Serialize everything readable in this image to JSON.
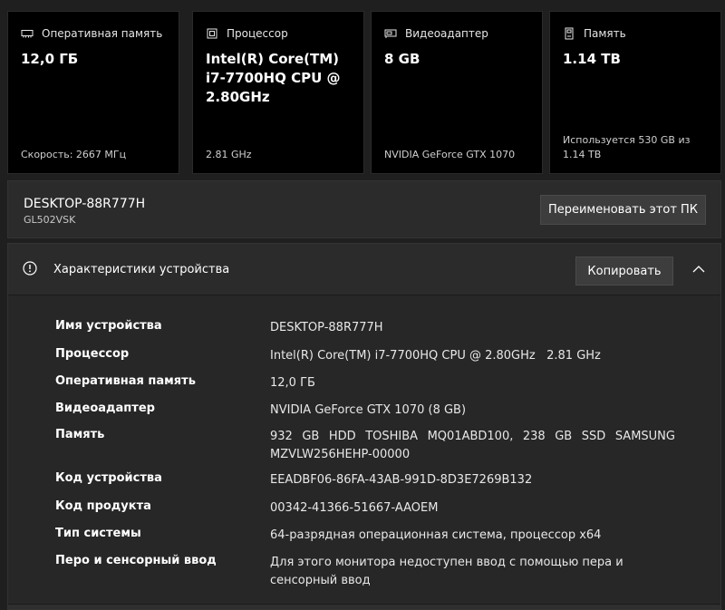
{
  "cards": [
    {
      "icon": "memory-icon",
      "title": "Оперативная память",
      "value": "12,0 ГБ",
      "footer": "Скорость: 2667 МГц"
    },
    {
      "icon": "cpu-icon",
      "title": "Процессор",
      "value": "Intel(R) Core(TM) i7-7700HQ CPU @ 2.80GHz",
      "footer": "2.81 GHz"
    },
    {
      "icon": "gpu-icon",
      "title": "Видеоадаптер",
      "value": "8 GB",
      "footer": "NVIDIA GeForce GTX 1070"
    },
    {
      "icon": "storage-icon",
      "title": "Память",
      "value": "1.14 TB",
      "footer": "Используется 530 GB из 1.14 TB"
    }
  ],
  "device": {
    "name": "DESKTOP-88R777H",
    "model": "GL502VSK",
    "rename_label": "Переименовать этот ПК"
  },
  "specs": {
    "icon": "info-icon",
    "title": "Характеристики устройства",
    "copy_label": "Копировать",
    "collapse_icon": "chevron-up-icon",
    "rows": [
      {
        "label": "Имя устройства",
        "value": "DESKTOP-88R777H"
      },
      {
        "label": "Процессор",
        "value": "Intel(R) Core(TM) i7-7700HQ CPU @ 2.80GHz   2.81 GHz"
      },
      {
        "label": "Оперативная память",
        "value": "12,0 ГБ"
      },
      {
        "label": "Видеоадаптер",
        "value": "NVIDIA GeForce GTX 1070 (8 GB)"
      },
      {
        "label": "Память",
        "value": "932 GB HDD TOSHIBA MQ01ABD100, 238 GB SSD SAMSUNG MZVLW256HEHP-00000"
      },
      {
        "label": "Код устройства",
        "value": "EEADBF06-86FA-43AB-991D-8D3E7269B132"
      },
      {
        "label": "Код продукта",
        "value": "00342-41366-51667-AAOEM"
      },
      {
        "label": "Тип системы",
        "value": "64-разрядная операционная система, процессор x64"
      },
      {
        "label": "Перо и сенсорный ввод",
        "value": "Для этого монитора недоступен ввод с помощью пера и сенсорный ввод"
      }
    ]
  },
  "colors": {
    "card_bg": "#000000",
    "panel_bg": "#2b2b2b",
    "button_bg": "#3d3d3d"
  }
}
